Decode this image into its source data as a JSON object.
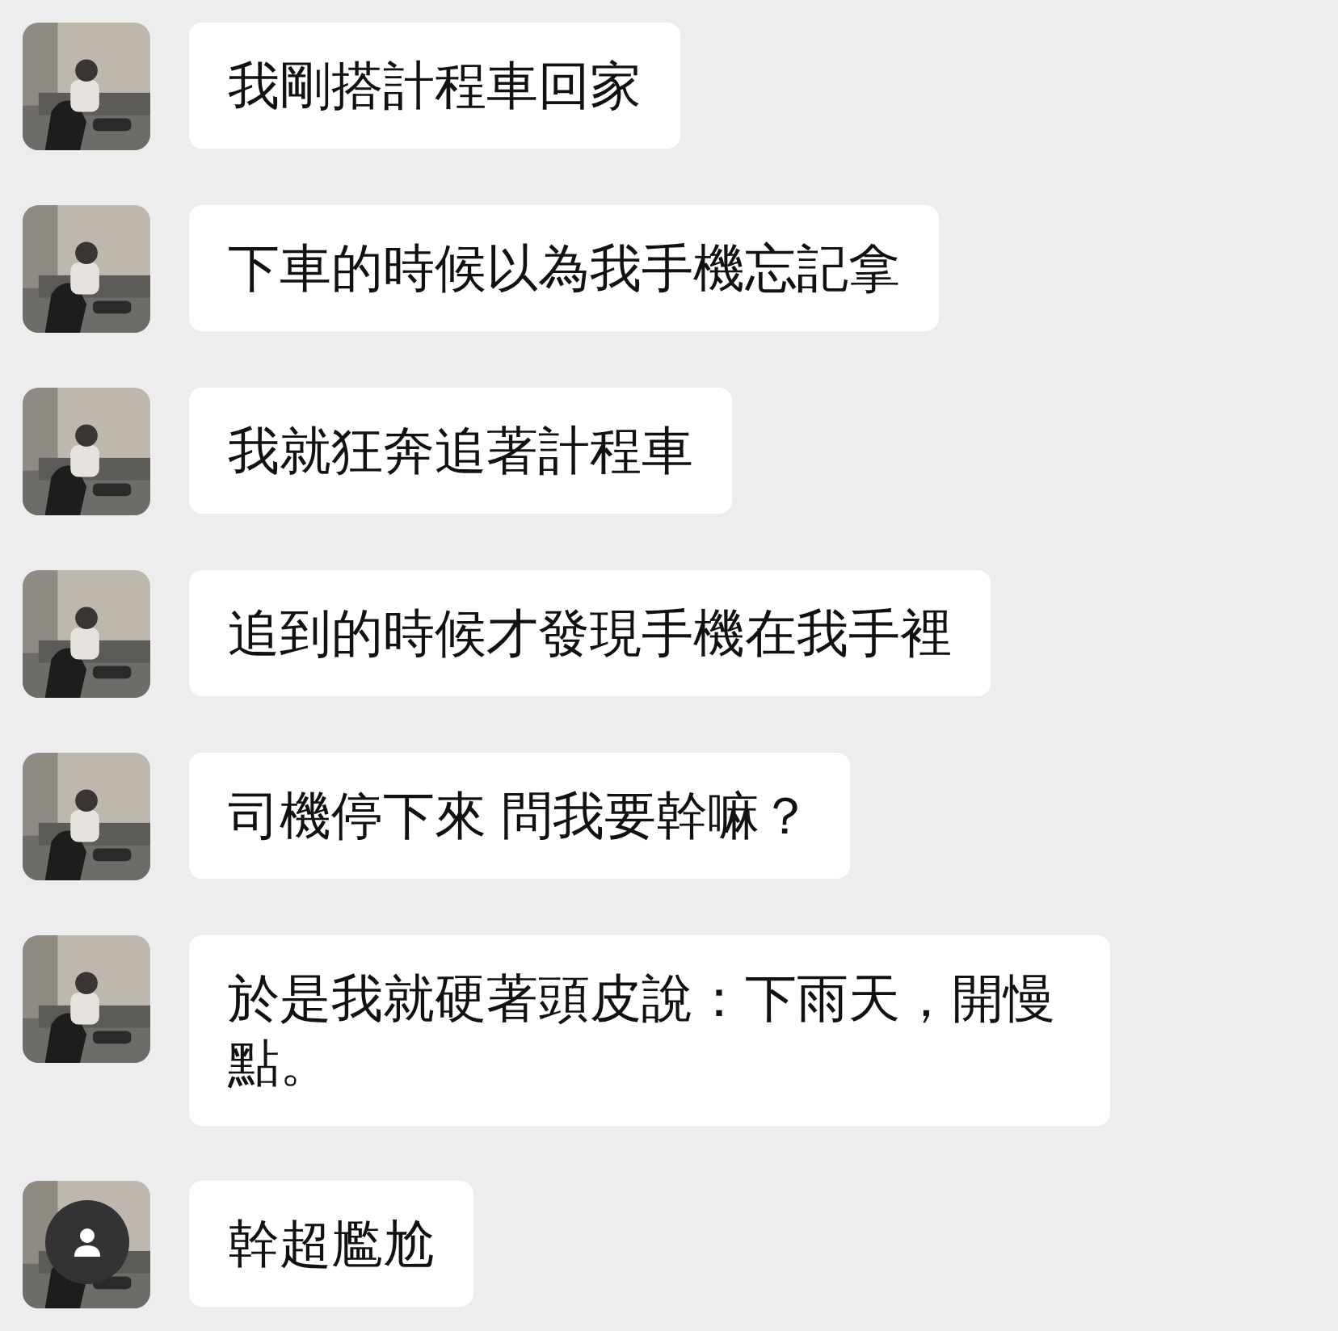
{
  "messages": [
    {
      "text": "我剛搭計程車回家",
      "avatar_overlay": false
    },
    {
      "text": "下車的時候以為我手機忘記拿",
      "avatar_overlay": false
    },
    {
      "text": "我就狂奔追著計程車",
      "avatar_overlay": false
    },
    {
      "text": "追到的時候才發現手機在我手裡",
      "avatar_overlay": false
    },
    {
      "text": "司機停下來 問我要幹嘛？",
      "avatar_overlay": false
    },
    {
      "text": "於是我就硬著頭皮說：下雨天，開慢點。",
      "avatar_overlay": false
    },
    {
      "text": "幹超尷尬",
      "avatar_overlay": true
    }
  ]
}
